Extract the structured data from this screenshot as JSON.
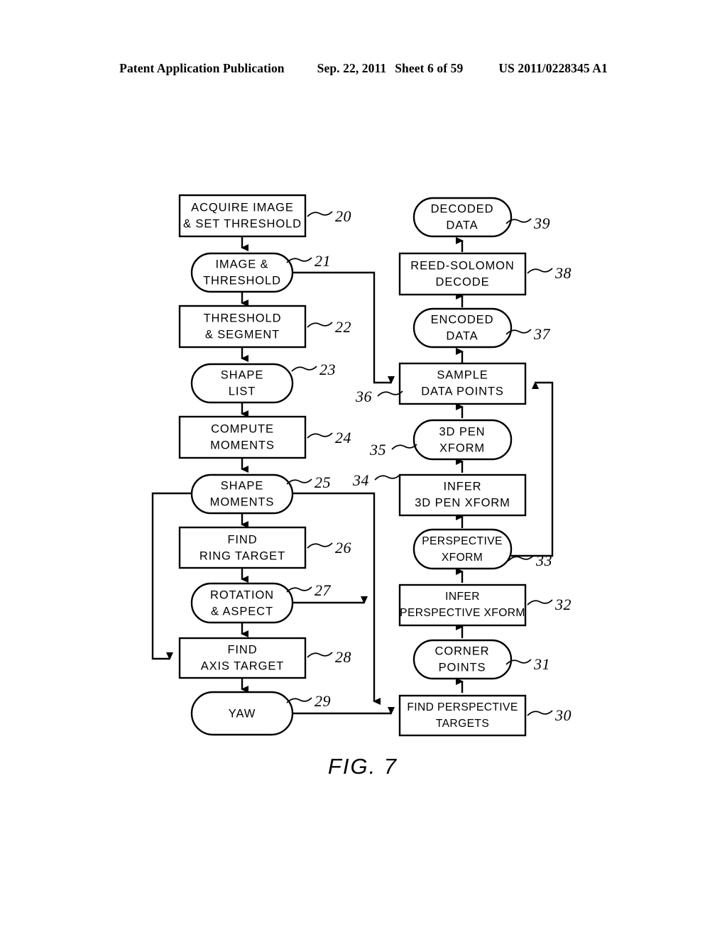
{
  "header": {
    "publication": "Patent Application Publication",
    "date": "Sep. 22, 2011",
    "sheet": "Sheet 6 of 59",
    "number": "US 2011/0228345 A1"
  },
  "figure": {
    "caption": "FIG. 7",
    "nodes": [
      {
        "id": "n20",
        "ref": "20",
        "shape": "rect",
        "lines": [
          "ACQUIRE IMAGE",
          "& SET THRESHOLD"
        ]
      },
      {
        "id": "n21",
        "ref": "21",
        "shape": "round",
        "lines": [
          "IMAGE &",
          "THRESHOLD"
        ]
      },
      {
        "id": "n22",
        "ref": "22",
        "shape": "rect",
        "lines": [
          "THRESHOLD",
          "& SEGMENT"
        ]
      },
      {
        "id": "n23",
        "ref": "23",
        "shape": "round",
        "lines": [
          "SHAPE",
          "LIST"
        ]
      },
      {
        "id": "n24",
        "ref": "24",
        "shape": "rect",
        "lines": [
          "COMPUTE",
          "MOMENTS"
        ]
      },
      {
        "id": "n25",
        "ref": "25",
        "shape": "round",
        "lines": [
          "SHAPE",
          "MOMENTS"
        ]
      },
      {
        "id": "n26",
        "ref": "26",
        "shape": "rect",
        "lines": [
          "FIND",
          "RING TARGET"
        ]
      },
      {
        "id": "n27",
        "ref": "27",
        "shape": "round",
        "lines": [
          "ROTATION",
          "& ASPECT"
        ]
      },
      {
        "id": "n28",
        "ref": "28",
        "shape": "rect",
        "lines": [
          "FIND",
          "AXIS TARGET"
        ]
      },
      {
        "id": "n29",
        "ref": "29",
        "shape": "round",
        "lines": [
          "YAW"
        ]
      },
      {
        "id": "n30",
        "ref": "30",
        "shape": "rect",
        "lines": [
          "FIND PERSPECTIVE",
          "TARGETS"
        ]
      },
      {
        "id": "n31",
        "ref": "31",
        "shape": "round",
        "lines": [
          "CORNER",
          "POINTS"
        ]
      },
      {
        "id": "n32",
        "ref": "32",
        "shape": "rect",
        "lines": [
          "INFER",
          "PERSPECTIVE XFORM"
        ]
      },
      {
        "id": "n33",
        "ref": "33",
        "shape": "round",
        "lines": [
          "PERSPECTIVE",
          "XFORM"
        ]
      },
      {
        "id": "n34",
        "ref": "34",
        "shape": "rect",
        "lines": [
          "INFER",
          "3D PEN XFORM"
        ]
      },
      {
        "id": "n35",
        "ref": "35",
        "shape": "round",
        "lines": [
          "3D PEN",
          "XFORM"
        ]
      },
      {
        "id": "n36",
        "ref": "36",
        "shape": "rect",
        "lines": [
          "SAMPLE",
          "DATA POINTS"
        ]
      },
      {
        "id": "n37",
        "ref": "37",
        "shape": "round",
        "lines": [
          "ENCODED",
          "DATA"
        ]
      },
      {
        "id": "n38",
        "ref": "38",
        "shape": "rect",
        "lines": [
          "REED-SOLOMON",
          "DECODE"
        ]
      },
      {
        "id": "n39",
        "ref": "39",
        "shape": "round",
        "lines": [
          "DECODED",
          "DATA"
        ]
      }
    ]
  }
}
